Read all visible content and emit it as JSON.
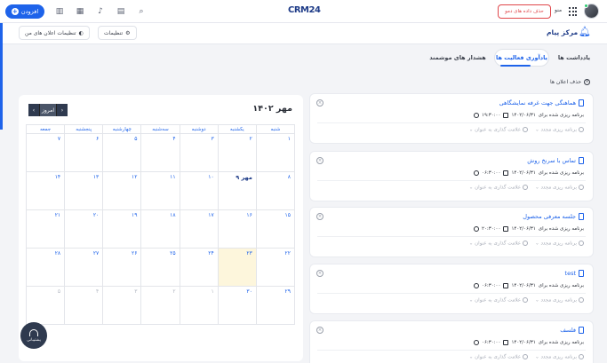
{
  "topbar": {
    "add_label": "افزودن",
    "logo": "CRM24",
    "demo_button": "حذف داده های دمو",
    "menu_label": "منو",
    "icons": [
      "chart-icon",
      "calendar-icon",
      "bell-icon",
      "clipboard-icon",
      "search-icon"
    ]
  },
  "subbar": {
    "notification_settings": "تنظیمات اعلان های من",
    "settings": "تنظیمات",
    "page_title": "مرکز پیام"
  },
  "tabs": [
    {
      "label": "یادداشت ها",
      "active": false
    },
    {
      "label": "یادآوری فعالیت ها",
      "active": true
    },
    {
      "label": "هشدار های موشمند",
      "active": false
    }
  ],
  "delete_all": "حذف اعلان ها",
  "calendar": {
    "title": "مهر ۱۴۰۲",
    "today_label": "امروز",
    "weekdays": [
      "جمعه",
      "پنجشنبه",
      "چهارشنبه",
      "سه‌شنبه",
      "دوشنبه",
      "یکشنبه",
      "شنبه"
    ],
    "rows": [
      [
        "۷",
        "۶",
        "۵",
        "۴",
        "۳",
        "۲",
        "۱"
      ],
      [
        "۱۴",
        "۱۳",
        "۱۲",
        "۱۱",
        "۱۰",
        "۹ مهر",
        "۸"
      ],
      [
        "۲۱",
        "۲۰",
        "۱۹",
        "۱۸",
        "۱۷",
        "۱۶",
        "۱۵"
      ],
      [
        "۲۸",
        "۲۷",
        "۲۶",
        "۲۵",
        "۲۴",
        "۲۳",
        "۲۲"
      ],
      [
        "۵",
        "۴",
        "۳",
        "۲",
        "۱",
        "۳۰",
        "۲۹"
      ]
    ]
  },
  "cards": [
    {
      "title": "هماهنگی جهت غرفه نمایشگاهی",
      "schedule_prefix": "برنامه ریزی شده برای",
      "date": "۱۴۰۲/۰۶/۳۱",
      "time": "۱۹:۳۰:۰۰",
      "reschedule": "برنامه ریزی مجدد",
      "mark_as": "علامت گذاری به عنوان"
    },
    {
      "title": "تماس با سرنخ روش",
      "schedule_prefix": "برنامه ریزی شده برای",
      "date": "۱۴۰۲/۰۶/۳۱",
      "time": "۰۶:۳۰:۰۰",
      "reschedule": "برنامه ریزی مجدد",
      "mark_as": "علامت گذاری به عنوان"
    },
    {
      "title": "جلسه معرفی محصول",
      "schedule_prefix": "برنامه ریزی شده برای",
      "date": "۱۴۰۲/۰۶/۳۱",
      "time": "۲۰:۳۰:۰۰",
      "reschedule": "برنامه ریزی مجدد",
      "mark_as": "علامت گذاری به عنوان"
    },
    {
      "title": "test",
      "schedule_prefix": "برنامه ریزی شده برای",
      "date": "۱۴۰۲/۰۶/۳۱",
      "time": "۰۶:۳۰:۰۰",
      "reschedule": "برنامه ریزی مجدد",
      "mark_as": "علامت گذاری به عنوان"
    },
    {
      "title": "فلسف",
      "schedule_prefix": "برنامه ریزی شده برای",
      "date": "۱۴۰۲/۰۶/۳۱",
      "time": "۰۶:۳۰:۰۰",
      "reschedule": "برنامه ریزی مجدد",
      "mark_as": "علامت گذاری به عنوان"
    }
  ],
  "support_label": "پشتیبانی",
  "colors": {
    "accent": "#1e63ea",
    "dark": "#2f3a4f",
    "danger": "#e0464a",
    "today_bg": "#fdf6dc"
  }
}
